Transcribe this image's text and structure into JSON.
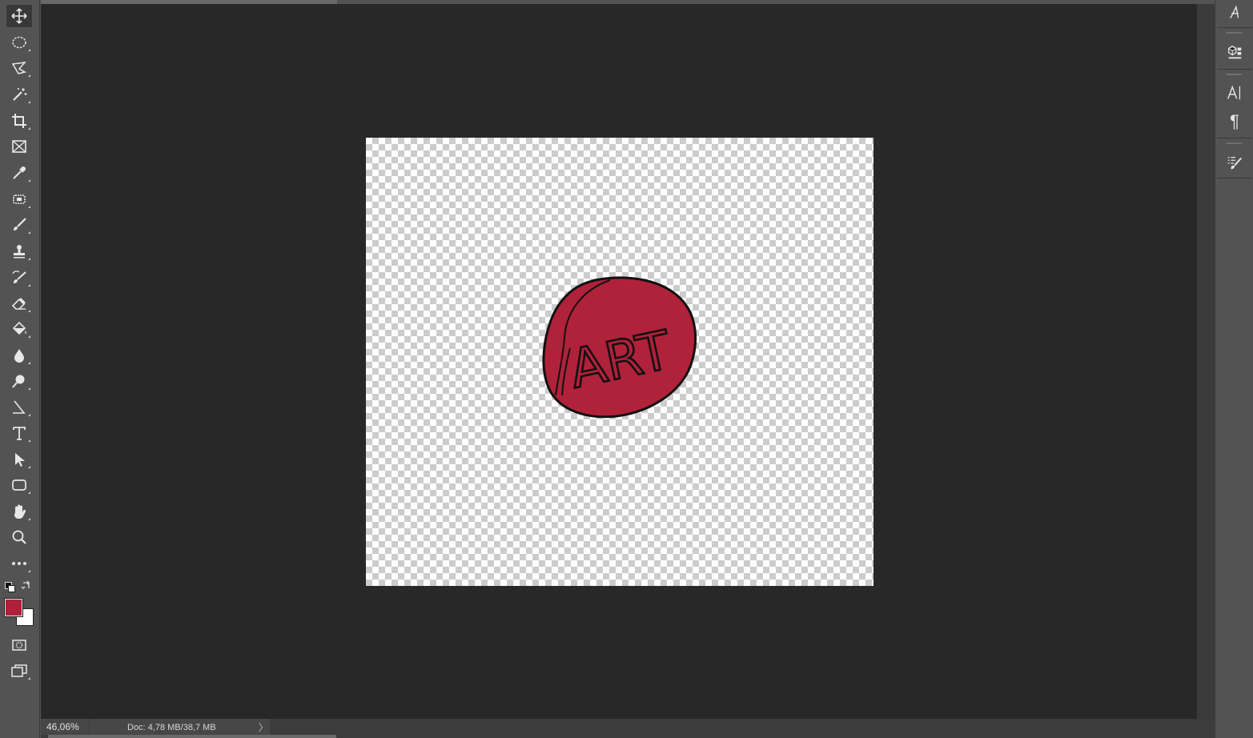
{
  "toolbar": {
    "tools": [
      {
        "name": "move-tool",
        "icon": "move-icon",
        "active": true
      },
      {
        "name": "elliptical-marquee-tool",
        "icon": "ellipse-marquee-icon"
      },
      {
        "name": "polygonal-lasso-tool",
        "icon": "lasso-icon"
      },
      {
        "name": "magic-wand-tool",
        "icon": "magic-wand-icon"
      },
      {
        "name": "crop-tool",
        "icon": "crop-icon"
      },
      {
        "name": "frame-tool",
        "icon": "frame-icon"
      },
      {
        "name": "eyedropper-tool",
        "icon": "eyedropper-icon"
      },
      {
        "name": "spot-healing-tool",
        "icon": "healing-icon"
      },
      {
        "name": "brush-tool",
        "icon": "brush-icon"
      },
      {
        "name": "clone-stamp-tool",
        "icon": "stamp-icon"
      },
      {
        "name": "history-brush-tool",
        "icon": "history-brush-icon"
      },
      {
        "name": "eraser-tool",
        "icon": "eraser-icon"
      },
      {
        "name": "paint-bucket-tool",
        "icon": "paint-bucket-icon"
      },
      {
        "name": "blur-tool",
        "icon": "blur-drop-icon"
      },
      {
        "name": "dodge-tool",
        "icon": "dodge-icon"
      },
      {
        "name": "pen-tool",
        "icon": "pen-icon"
      },
      {
        "name": "type-tool",
        "icon": "type-icon"
      },
      {
        "name": "path-selection-tool",
        "icon": "arrow-select-icon"
      },
      {
        "name": "rectangle-tool",
        "icon": "rounded-rect-icon"
      },
      {
        "name": "hand-tool",
        "icon": "hand-icon"
      },
      {
        "name": "zoom-tool",
        "icon": "zoom-icon"
      },
      {
        "name": "edit-toolbar",
        "icon": "more-icon"
      }
    ],
    "foreground_color": "#b0203a",
    "background_color": "#ffffff"
  },
  "canvas": {
    "artwork_text": "ART",
    "fill_color": "#b0213a"
  },
  "status": {
    "zoom": "46,06%",
    "doc_info": "Doc: 4,78 MB/38,7 MB",
    "arrow": "〉"
  },
  "right_dock": {
    "buttons": [
      {
        "name": "character-styles-button",
        "icon": "script-a-icon"
      },
      {
        "name": "3d-button",
        "icon": "3d-icon"
      },
      {
        "name": "character-button",
        "icon": "character-icon"
      },
      {
        "name": "paragraph-button",
        "icon": "pilcrow-icon",
        "label": "¶"
      },
      {
        "name": "brush-settings-button",
        "icon": "brush-settings-icon"
      }
    ]
  }
}
